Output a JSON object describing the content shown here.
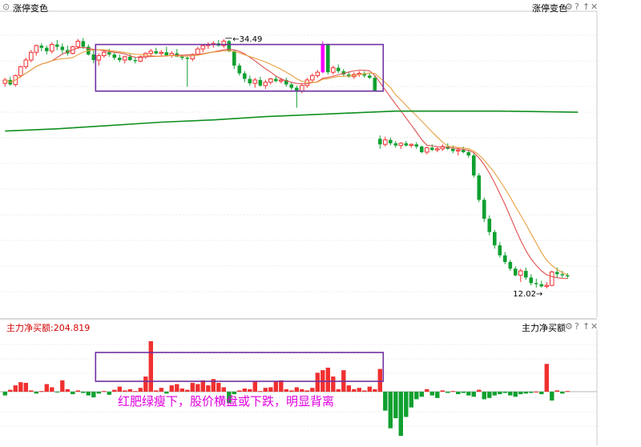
{
  "top_panel": {
    "title": "涨停变色",
    "right_title": "涨停变色",
    "menu_icon": "chevron-down-icon",
    "icons": [
      "gear-icon",
      "help-icon",
      "up-arrow-icon",
      "close-icon"
    ]
  },
  "bottom_panel": {
    "left_label": "主力净买额:204.819",
    "right_title": "主力净买额",
    "icons": [
      "gear-icon",
      "help-icon",
      "up-arrow-icon",
      "close-icon"
    ]
  },
  "colors": {
    "up": "#f03030",
    "down": "#10a030",
    "limit_up": "#ff00ff",
    "ma_short": "#e05050",
    "ma_mid": "#e8a040",
    "ma_long": "#109020",
    "box": "#7030a0",
    "annotation": "#e000e0",
    "grid": "#c0c0c0"
  },
  "chart_data": [
    {
      "type": "candlestick",
      "title": "涨停变色",
      "ylim": [
        10,
        37
      ],
      "grid": true,
      "annotations": [
        {
          "text": "34.49",
          "label": "high",
          "at_index": 42,
          "value": 34.49
        },
        {
          "text": "12.02",
          "label": "low",
          "at_index": 104,
          "value": 12.02
        }
      ],
      "highlight_box": {
        "from_index": 18,
        "to_index": 72,
        "low": 29.8,
        "high": 34.0
      },
      "candles": [
        [
          30.5,
          31.0,
          30.2,
          30.8
        ],
        [
          30.8,
          31.1,
          30.3,
          30.4
        ],
        [
          30.4,
          31.3,
          30.2,
          31.2
        ],
        [
          31.2,
          32.1,
          31.0,
          32.0
        ],
        [
          32.0,
          32.8,
          31.8,
          32.6
        ],
        [
          32.6,
          33.5,
          32.4,
          33.3
        ],
        [
          33.3,
          34.0,
          33.0,
          33.9
        ],
        [
          33.9,
          34.1,
          33.4,
          33.7
        ],
        [
          33.7,
          33.9,
          33.1,
          33.4
        ],
        [
          33.4,
          34.2,
          33.2,
          34.0
        ],
        [
          34.0,
          34.4,
          33.5,
          33.8
        ],
        [
          33.8,
          34.1,
          33.2,
          33.5
        ],
        [
          33.5,
          33.9,
          33.0,
          33.2
        ],
        [
          33.2,
          33.9,
          33.1,
          33.8
        ],
        [
          33.8,
          34.5,
          33.6,
          34.3
        ],
        [
          34.3,
          34.6,
          33.6,
          33.8
        ],
        [
          33.8,
          34.0,
          33.0,
          33.1
        ],
        [
          33.1,
          33.6,
          32.3,
          32.6
        ],
        [
          32.6,
          33.2,
          32.1,
          33.0
        ],
        [
          33.0,
          33.5,
          32.8,
          33.3
        ],
        [
          33.3,
          33.6,
          32.9,
          33.1
        ],
        [
          33.1,
          33.3,
          32.6,
          32.8
        ],
        [
          32.8,
          33.1,
          32.4,
          32.6
        ],
        [
          32.6,
          33.0,
          32.3,
          32.9
        ],
        [
          32.9,
          33.2,
          32.5,
          32.6
        ],
        [
          32.6,
          32.9,
          32.3,
          32.5
        ],
        [
          32.5,
          33.0,
          32.4,
          32.9
        ],
        [
          32.9,
          33.3,
          32.7,
          33.2
        ],
        [
          33.2,
          33.6,
          33.0,
          33.4
        ],
        [
          33.4,
          33.7,
          33.1,
          33.2
        ],
        [
          33.2,
          33.5,
          32.9,
          33.3
        ],
        [
          33.3,
          33.8,
          33.1,
          33.0
        ],
        [
          33.0,
          33.4,
          32.8,
          33.2
        ],
        [
          33.2,
          33.6,
          32.9,
          32.9
        ],
        [
          32.9,
          33.1,
          32.6,
          32.8
        ],
        [
          32.8,
          33.0,
          30.2,
          32.7
        ],
        [
          32.7,
          33.2,
          32.5,
          33.1
        ],
        [
          33.1,
          33.8,
          33.0,
          33.6
        ],
        [
          33.6,
          34.0,
          33.3,
          33.9
        ],
        [
          33.9,
          34.2,
          33.6,
          34.0
        ],
        [
          34.0,
          34.3,
          33.7,
          34.1
        ],
        [
          34.1,
          34.4,
          33.8,
          33.9
        ],
        [
          33.9,
          34.49,
          33.7,
          34.3
        ],
        [
          34.3,
          34.4,
          33.3,
          33.4
        ],
        [
          33.4,
          33.5,
          31.8,
          32.1
        ],
        [
          32.1,
          32.3,
          31.2,
          31.4
        ],
        [
          31.4,
          31.6,
          30.6,
          30.9
        ],
        [
          30.9,
          31.2,
          30.3,
          30.5
        ],
        [
          30.5,
          31.0,
          30.1,
          30.8
        ],
        [
          30.8,
          31.1,
          30.2,
          30.3
        ],
        [
          30.3,
          30.8,
          30.0,
          30.6
        ],
        [
          30.6,
          31.0,
          30.4,
          30.9
        ],
        [
          30.9,
          31.2,
          30.6,
          30.7
        ],
        [
          30.7,
          31.0,
          30.5,
          30.8
        ],
        [
          30.8,
          31.0,
          30.2,
          30.4
        ],
        [
          30.4,
          30.6,
          29.9,
          30.1
        ],
        [
          30.1,
          30.3,
          28.3,
          29.8
        ],
        [
          29.8,
          30.5,
          29.6,
          30.3
        ],
        [
          30.3,
          31.0,
          30.1,
          30.8
        ],
        [
          30.8,
          31.4,
          30.6,
          31.2
        ],
        [
          31.2,
          31.7,
          31.0,
          31.5
        ],
        [
          31.5,
          34.3,
          31.4,
          34.0
        ],
        [
          34.0,
          34.1,
          31.3,
          31.5
        ],
        [
          31.5,
          32.1,
          31.3,
          31.9
        ],
        [
          31.9,
          32.2,
          31.4,
          31.6
        ],
        [
          31.6,
          31.8,
          31.1,
          31.3
        ],
        [
          31.3,
          31.5,
          31.0,
          31.1
        ],
        [
          31.1,
          31.5,
          30.9,
          31.3
        ],
        [
          31.3,
          31.6,
          31.1,
          31.4
        ],
        [
          31.4,
          31.6,
          31.0,
          31.2
        ],
        [
          31.2,
          31.4,
          30.9,
          31.0
        ],
        [
          31.0,
          31.2,
          30.8,
          29.8
        ],
        [
          25.5,
          25.8,
          24.6,
          25.0
        ],
        [
          25.0,
          25.7,
          24.8,
          25.4
        ],
        [
          25.4,
          25.6,
          24.9,
          25.1
        ],
        [
          25.1,
          25.3,
          24.7,
          24.9
        ],
        [
          24.9,
          25.2,
          24.6,
          25.1
        ],
        [
          25.1,
          25.3,
          24.8,
          24.9
        ],
        [
          24.9,
          25.1,
          24.7,
          25.0
        ],
        [
          25.0,
          25.2,
          24.6,
          24.8
        ],
        [
          24.8,
          24.9,
          24.2,
          24.3
        ],
        [
          24.3,
          24.8,
          24.1,
          24.7
        ],
        [
          24.7,
          25.0,
          24.4,
          24.5
        ],
        [
          24.5,
          24.8,
          24.3,
          24.6
        ],
        [
          24.6,
          25.0,
          24.4,
          24.8
        ],
        [
          24.8,
          25.1,
          24.5,
          24.6
        ],
        [
          24.6,
          24.9,
          24.2,
          24.4
        ],
        [
          24.4,
          24.7,
          24.0,
          24.5
        ],
        [
          24.5,
          24.8,
          24.2,
          24.3
        ],
        [
          24.3,
          24.5,
          23.8,
          24.0
        ],
        [
          24.0,
          24.2,
          22.0,
          22.2
        ],
        [
          22.2,
          22.4,
          19.8,
          20.0
        ],
        [
          20.0,
          20.2,
          18.0,
          18.3
        ],
        [
          18.3,
          18.6,
          16.8,
          17.1
        ],
        [
          17.1,
          17.3,
          15.6,
          15.9
        ],
        [
          15.9,
          16.2,
          14.8,
          15.0
        ],
        [
          15.0,
          15.3,
          14.2,
          14.4
        ],
        [
          14.4,
          14.6,
          13.6,
          13.8
        ],
        [
          13.8,
          14.0,
          13.1,
          13.2
        ],
        [
          13.2,
          13.8,
          12.6,
          13.6
        ],
        [
          13.6,
          13.9,
          12.8,
          13.0
        ],
        [
          13.0,
          13.3,
          12.3,
          12.5
        ],
        [
          12.5,
          12.9,
          12.1,
          12.4
        ],
        [
          12.4,
          12.7,
          12.1,
          12.2
        ],
        [
          12.2,
          12.6,
          12.02,
          12.3
        ],
        [
          12.3,
          13.6,
          12.2,
          13.5
        ],
        [
          13.5,
          13.9,
          13.0,
          13.3
        ],
        [
          13.3,
          13.6,
          13.0,
          13.2
        ],
        [
          13.2,
          13.4,
          12.9,
          13.1
        ]
      ],
      "series": [
        {
          "type": "line",
          "label": "MA-short"
        },
        {
          "type": "line",
          "label": "MA-mid"
        },
        {
          "type": "line",
          "label": "MA-long",
          "values": [
            [
              0,
              26.2
            ],
            [
              10,
              26.4
            ],
            [
              20,
              26.7
            ],
            [
              30,
              27.0
            ],
            [
              40,
              27.2
            ],
            [
              50,
              27.5
            ],
            [
              60,
              27.7
            ],
            [
              70,
              27.9
            ],
            [
              75,
              28.0
            ],
            [
              85,
              28.0
            ],
            [
              95,
              28.0
            ],
            [
              110,
              27.9
            ]
          ]
        }
      ]
    },
    {
      "type": "bar",
      "title": "主力净买额",
      "ylim": [
        -80,
        90
      ],
      "grid": true,
      "highlight_box": {
        "from_index": 18,
        "to_index": 72
      },
      "values": [
        -6,
        3,
        10,
        15,
        14,
        2,
        -3,
        1,
        12,
        7,
        -1,
        18,
        4,
        -4,
        2,
        -2,
        -6,
        -9,
        -3,
        1,
        -5,
        3,
        8,
        2,
        4,
        1,
        6,
        24,
        80,
        2,
        6,
        -3,
        10,
        12,
        5,
        3,
        14,
        12,
        18,
        10,
        20,
        14,
        7,
        -18,
        -4,
        2,
        5,
        4,
        16,
        1,
        6,
        7,
        16,
        18,
        4,
        2,
        7,
        4,
        2,
        6,
        30,
        34,
        38,
        24,
        4,
        34,
        10,
        4,
        6,
        2,
        8,
        4,
        36,
        -30,
        -58,
        -42,
        -70,
        -40,
        -25,
        -12,
        -8,
        4,
        -6,
        -10,
        2,
        -2,
        1,
        -4,
        -2,
        -6,
        -8,
        3,
        -12,
        -10,
        -6,
        -4,
        -2,
        -6,
        -8,
        -4,
        -3,
        -2,
        0,
        -4,
        44,
        -14,
        2,
        -3,
        1
      ]
    }
  ],
  "annotation_text": "红肥绿瘦下，股价横盘或下跌，明显背离"
}
